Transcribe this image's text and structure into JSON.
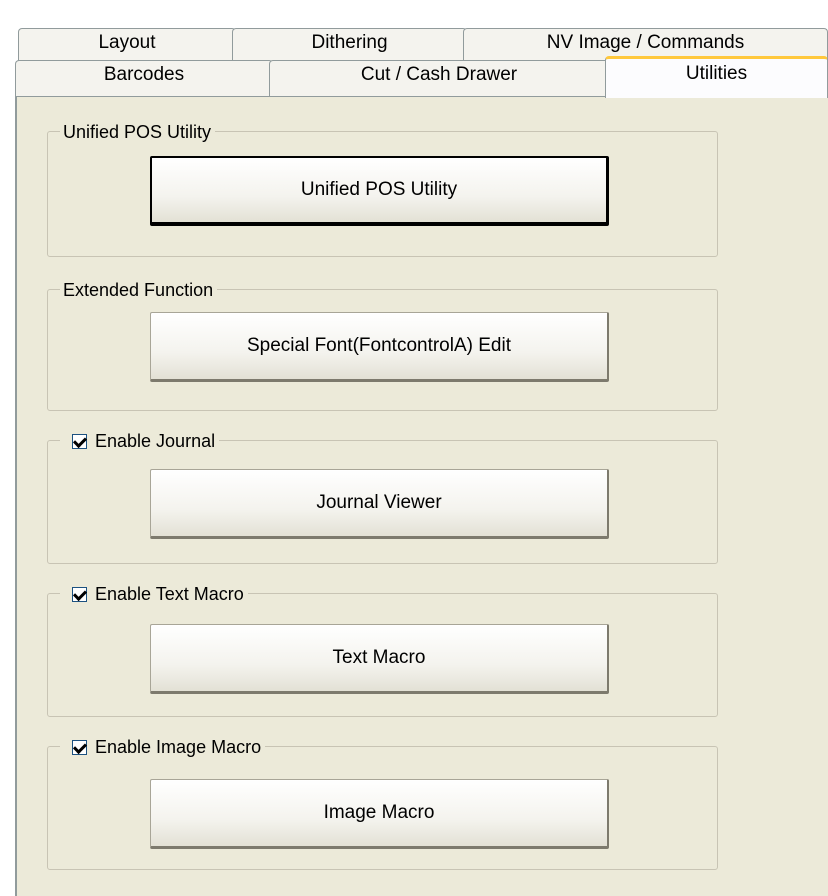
{
  "tabs_row1": [
    {
      "label": "Layout"
    },
    {
      "label": "Dithering"
    },
    {
      "label": "NV Image / Commands"
    }
  ],
  "tabs_row2": [
    {
      "label": "Barcodes"
    },
    {
      "label": "Cut / Cash Drawer"
    },
    {
      "label": "Utilities",
      "active": true
    }
  ],
  "groups": {
    "upos": {
      "title": "Unified POS Utility",
      "button": "Unified POS Utility"
    },
    "extended": {
      "title": "Extended Function",
      "button": "Special Font(FontcontrolA) Edit"
    },
    "journal": {
      "title": "Enable Journal",
      "checked": true,
      "button": "Journal Viewer"
    },
    "text_macro": {
      "title": "Enable Text Macro",
      "checked": true,
      "button": "Text Macro"
    },
    "image_macro": {
      "title": "Enable Image Macro",
      "checked": true,
      "button": "Image Macro"
    }
  },
  "colors": {
    "panel": "#ecead9",
    "tab": "#f4f3ee",
    "active_tab_accent": "#ffc83c",
    "border": "#919b9c"
  }
}
